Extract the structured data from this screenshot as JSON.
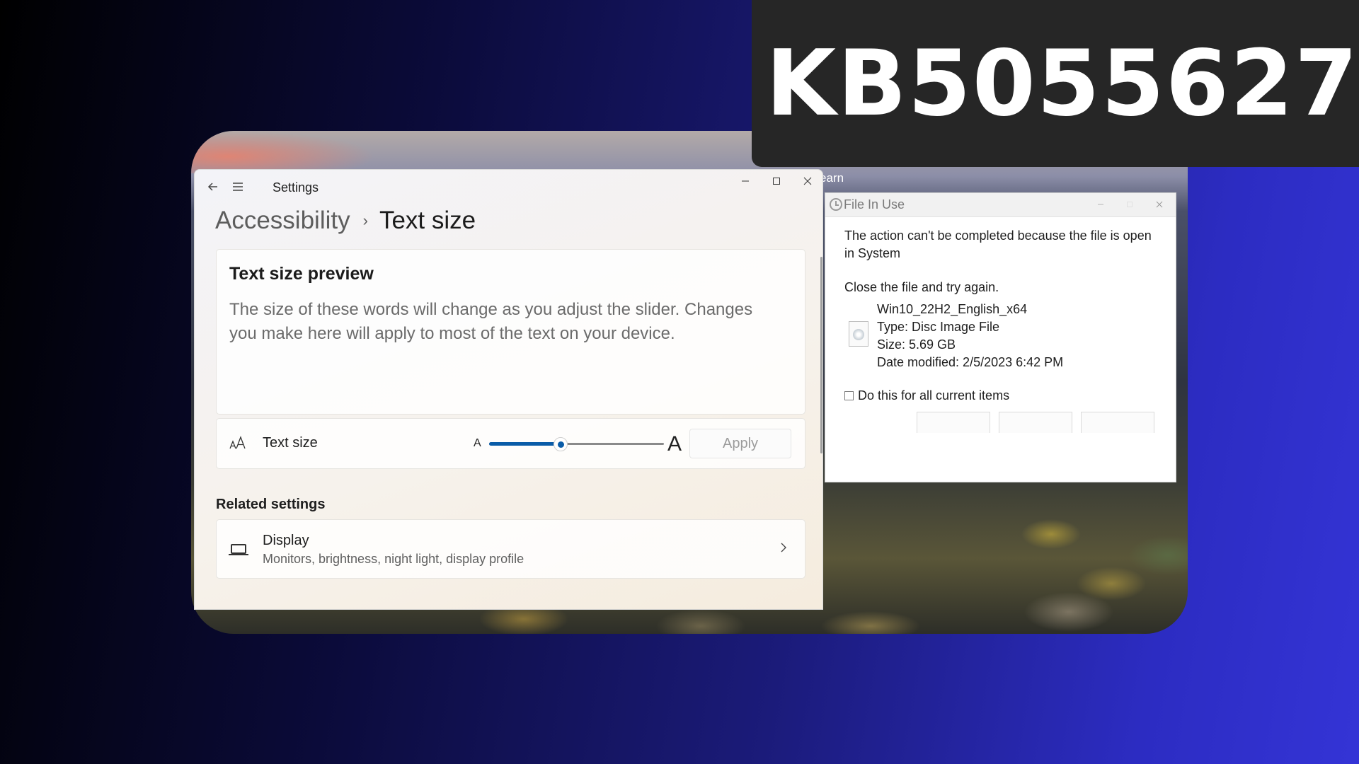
{
  "banner": {
    "title": "KB5055627"
  },
  "background_window": {
    "partial_text": "earn"
  },
  "settings": {
    "window_title": "Settings",
    "breadcrumb": {
      "parent": "Accessibility",
      "separator": "›",
      "current": "Text size"
    },
    "preview": {
      "title": "Text size preview",
      "body": "The size of these words will change as you adjust the slider. Changes you make here will apply to most of the text on your device."
    },
    "text_size": {
      "label": "Text size",
      "small_marker": "A",
      "large_marker": "A",
      "slider_value_fraction": 0.41,
      "apply_label": "Apply"
    },
    "related": {
      "title": "Related settings",
      "display": {
        "title": "Display",
        "subtitle": "Monitors, brightness, night light, display profile"
      }
    },
    "icons": {
      "back": "back-arrow-icon",
      "menu": "hamburger-menu-icon",
      "text_size": "text-size-icon",
      "display": "monitor-icon",
      "chevron": "chevron-right-icon"
    }
  },
  "dialog": {
    "title": "File In Use",
    "message": "The action can't be completed because the file is open in System",
    "instruction": "Close the file and try again.",
    "file": {
      "name": "Win10_22H2_English_x64",
      "type": "Type: Disc Image File",
      "size": "Size: 5.69 GB",
      "modified": "Date modified: 2/5/2023 6:42 PM"
    },
    "checkbox_label": "Do this for all current items",
    "checkbox_checked": false
  },
  "colors": {
    "accent": "#0a5ca8",
    "banner_bg": "#262626",
    "background_dark": "#000000",
    "background_blue": "#3434d6"
  }
}
